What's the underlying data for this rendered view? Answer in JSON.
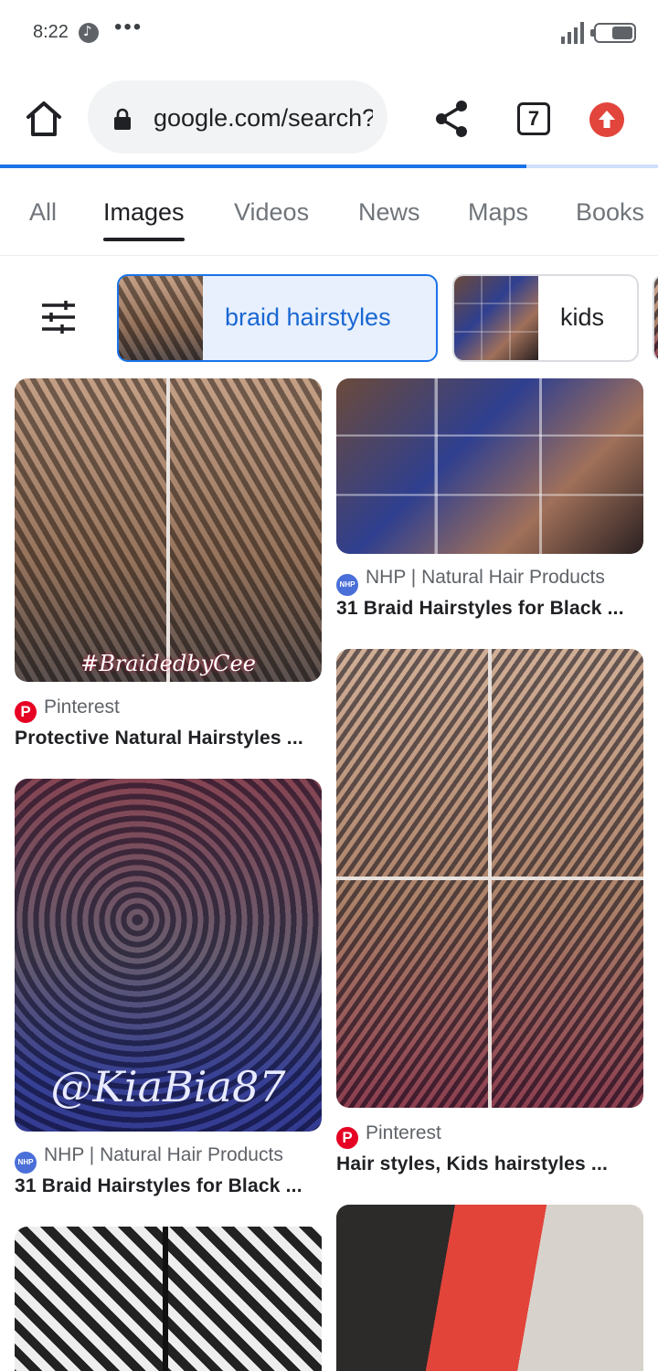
{
  "status_bar": {
    "time": "8:22",
    "overflow": "•••",
    "icons": [
      "music-notification-icon",
      "signal-icon",
      "battery-icon"
    ]
  },
  "browser": {
    "url": "google.com/search?",
    "tab_count": "7",
    "progress_percent": 80,
    "icons": [
      "home-icon",
      "lock-icon",
      "share-icon",
      "tabs-icon",
      "update-icon"
    ]
  },
  "search_tabs": [
    {
      "label": "All",
      "active": false
    },
    {
      "label": "Images",
      "active": true
    },
    {
      "label": "Videos",
      "active": false
    },
    {
      "label": "News",
      "active": false
    },
    {
      "label": "Maps",
      "active": false
    },
    {
      "label": "Books",
      "active": false
    }
  ],
  "chips": [
    {
      "label": "braid hairstyles",
      "selected": true
    },
    {
      "label": "kids",
      "selected": false
    }
  ],
  "results": {
    "left": [
      {
        "source": "Pinterest",
        "source_icon": "pinterest-icon",
        "title": "Protective Natural Hairstyles ...",
        "watermark": "#BraidedbyCee"
      },
      {
        "source": "NHP | Natural Hair Products",
        "source_icon": "nhp-icon",
        "title": "31 Braid Hairstyles for Black ...",
        "watermark": "@KiaBia87"
      },
      {
        "source": "",
        "title": ""
      }
    ],
    "right": [
      {
        "source": "NHP | Natural Hair Products",
        "source_icon": "nhp-icon",
        "title": "31 Braid Hairstyles for Black ..."
      },
      {
        "source": "Pinterest",
        "source_icon": "pinterest-icon",
        "title": "Hair styles, Kids hairstyles ..."
      },
      {
        "source": "",
        "title": ""
      }
    ]
  },
  "colors": {
    "accent": "#1a73e8",
    "chip_selected_bg": "#e8f0fe",
    "update_button": "#e2453c",
    "pinterest": "#e60023"
  }
}
